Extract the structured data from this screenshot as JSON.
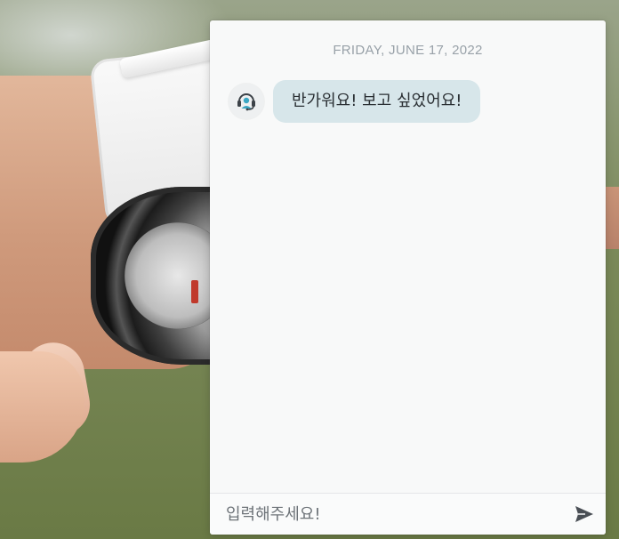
{
  "chat": {
    "date_label": "FRIDAY, JUNE 17, 2022",
    "messages": [
      {
        "sender": "bot",
        "avatar_icon": "support-agent-icon",
        "text": "반가워요! 보고 싶었어요!"
      }
    ],
    "composer": {
      "placeholder": "입력해주세요!",
      "value": "",
      "send_icon": "send-icon"
    }
  },
  "colors": {
    "panel_bg": "#f8f9f9",
    "bubble_bg": "#d7e6ea",
    "date_text": "#98a1a8",
    "send_icon": "#4a4f55",
    "avatar_accent": "#3aa7c4"
  }
}
